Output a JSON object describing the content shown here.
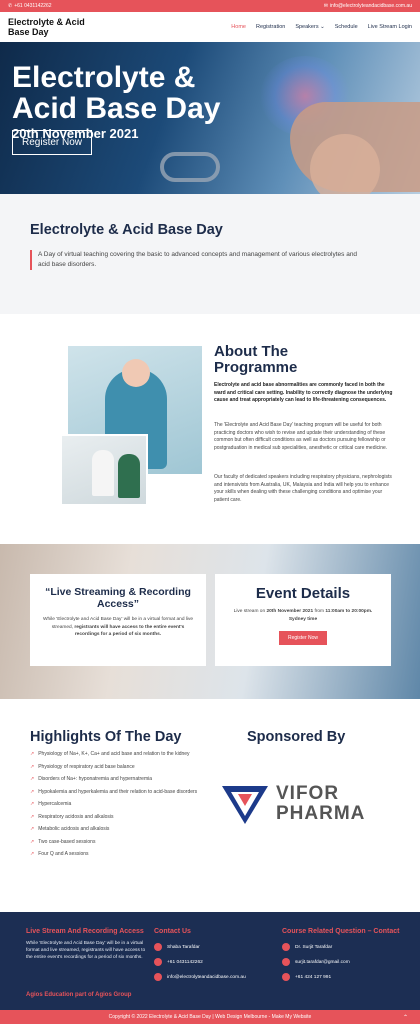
{
  "topbar": {
    "phone": "+61 0431142262",
    "email": "info@electrolyteandacidbase.com.au"
  },
  "nav": {
    "logo": "Electrolyte & Acid\nBase Day",
    "items": [
      "Home",
      "Registration",
      "Speakers",
      "Schedule",
      "Live Stream Login"
    ]
  },
  "hero": {
    "title_line1": "Electrolyte &",
    "title_line2": "Acid Base Day",
    "date": "20th November 2021",
    "button": "Register Now"
  },
  "intro": {
    "heading": "Electrolyte & Acid Base Day",
    "text": "A Day of virtual teaching covering the basic to advanced concepts and management of various electrolytes and acid base disorders."
  },
  "about": {
    "heading_line1": "About The",
    "heading_line2": "Programme",
    "bold": "Electrolyte and acid base abnormalities are commonly faced in both the ward and critical care setting. Inability to correctly diagnose the underlying cause and treat appropriately can lead to life-threatening consequences.",
    "p1": "The 'Electrolyte and Acid Base Day' teaching program will be useful for both practicing doctors who wish to revise and update their understanding of these common but often difficult conditions as well as doctors pursuing fellowship or postgraduation in medical sub specialities, anesthetic or critical care medicine.",
    "p2": "Our faculty of dedicated speakers including respiratory physicians, nephrologists and intensivists from Australia, UK, Malaysia and India will help you to enhance your skills when dealing with these challenging conditions and optimise your patient care."
  },
  "live": {
    "heading": "“Live Streaming & Recording Access”",
    "text_a": "While 'Electrolyte and Acid Base Day' will be in a virtual format and live streamed, ",
    "text_b": "registrants will have access to the entire event's recordings for a period of six months."
  },
  "event": {
    "heading": "Event Details",
    "line_a": "Live stream on ",
    "date": "20th November 2021",
    "line_b": " from ",
    "time": "11:00am to 20:00pm.",
    "tz": "Sydney time",
    "button": "Register Now"
  },
  "highlights": {
    "heading": "Highlights Of The Day",
    "items": [
      "Physiology of Na+, K+, Ca+ and acid base and relation to the kidney",
      "Physiology of respiratory acid base balance",
      "Disorders of Na+: hyponatremia and hypernatremia",
      "Hypokalemia and hyperkalemia and their relation to acid-base disorders",
      "Hypercalcemia",
      "Respiratory acidosis and alkalosis",
      "Metabolic acidosis and alkalosis",
      "Two case-based sessions",
      "Four Q and A sessions"
    ]
  },
  "sponsor": {
    "heading": "Sponsored By",
    "logo_line1": "VIFOR",
    "logo_line2": "PHARMA"
  },
  "footer": {
    "col1_heading": "Live Stream And Recording Access",
    "col1_text": "While 'Electrolyte and Acid Base Day' will be in a virtual format and live streamed, registrants will have access to the entire event's recordings for a period of six months.",
    "col2_heading": "Contact Us",
    "col2_name": "Shaba Tarafdar",
    "col2_phone": "+61 0431142262",
    "col2_email": "info@electrolyteandacidbase.com.au",
    "col3_heading": "Course Related Question – Contact",
    "col3_name": "Dr. Surjit Tarafdar",
    "col3_email": "surjit.tarafdar@gmail.com",
    "col3_phone": "+61 424 127 991",
    "agios": "Agios Education part of Agios Group"
  },
  "copyright": "Copyright © 2022 Electrolyte & Acid Base Day | Web Design Melbourne - Make My Website",
  "colors": {
    "accent": "#e6535a",
    "navy": "#1c2e53"
  }
}
